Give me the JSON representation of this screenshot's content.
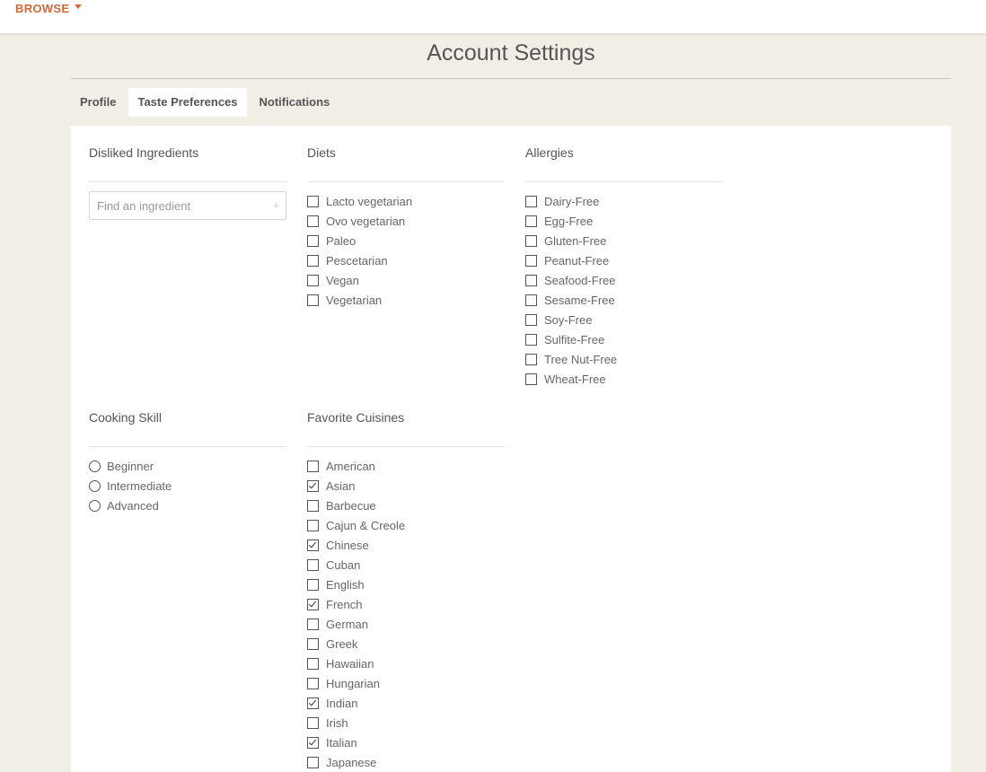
{
  "header": {
    "browse_label": "BROWSE"
  },
  "page": {
    "title": "Account Settings"
  },
  "tabs": [
    {
      "label": "Profile",
      "active": false
    },
    {
      "label": "Taste Preferences",
      "active": true
    },
    {
      "label": "Notifications",
      "active": false
    }
  ],
  "disliked": {
    "title": "Disliked Ingredients",
    "placeholder": "Find an ingredient",
    "add_icon": "plus-icon"
  },
  "diets": {
    "title": "Diets",
    "items": [
      {
        "label": "Lacto vegetarian",
        "checked": false
      },
      {
        "label": "Ovo vegetarian",
        "checked": false
      },
      {
        "label": "Paleo",
        "checked": false
      },
      {
        "label": "Pescetarian",
        "checked": false
      },
      {
        "label": "Vegan",
        "checked": false
      },
      {
        "label": "Vegetarian",
        "checked": false
      }
    ]
  },
  "allergies": {
    "title": "Allergies",
    "items": [
      {
        "label": "Dairy-Free",
        "checked": false
      },
      {
        "label": "Egg-Free",
        "checked": false
      },
      {
        "label": "Gluten-Free",
        "checked": false
      },
      {
        "label": "Peanut-Free",
        "checked": false
      },
      {
        "label": "Seafood-Free",
        "checked": false
      },
      {
        "label": "Sesame-Free",
        "checked": false
      },
      {
        "label": "Soy-Free",
        "checked": false
      },
      {
        "label": "Sulfite-Free",
        "checked": false
      },
      {
        "label": "Tree Nut-Free",
        "checked": false
      },
      {
        "label": "Wheat-Free",
        "checked": false
      }
    ]
  },
  "skill": {
    "title": "Cooking Skill",
    "items": [
      {
        "label": "Beginner",
        "selected": false
      },
      {
        "label": "Intermediate",
        "selected": false
      },
      {
        "label": "Advanced",
        "selected": false
      }
    ]
  },
  "cuisines": {
    "title": "Favorite Cuisines",
    "items": [
      {
        "label": "American",
        "checked": false
      },
      {
        "label": "Asian",
        "checked": true
      },
      {
        "label": "Barbecue",
        "checked": false
      },
      {
        "label": "Cajun & Creole",
        "checked": false
      },
      {
        "label": "Chinese",
        "checked": true
      },
      {
        "label": "Cuban",
        "checked": false
      },
      {
        "label": "English",
        "checked": false
      },
      {
        "label": "French",
        "checked": true
      },
      {
        "label": "German",
        "checked": false
      },
      {
        "label": "Greek",
        "checked": false
      },
      {
        "label": "Hawaiian",
        "checked": false
      },
      {
        "label": "Hungarian",
        "checked": false
      },
      {
        "label": "Indian",
        "checked": true
      },
      {
        "label": "Irish",
        "checked": false
      },
      {
        "label": "Italian",
        "checked": true
      },
      {
        "label": "Japanese",
        "checked": false
      }
    ]
  }
}
